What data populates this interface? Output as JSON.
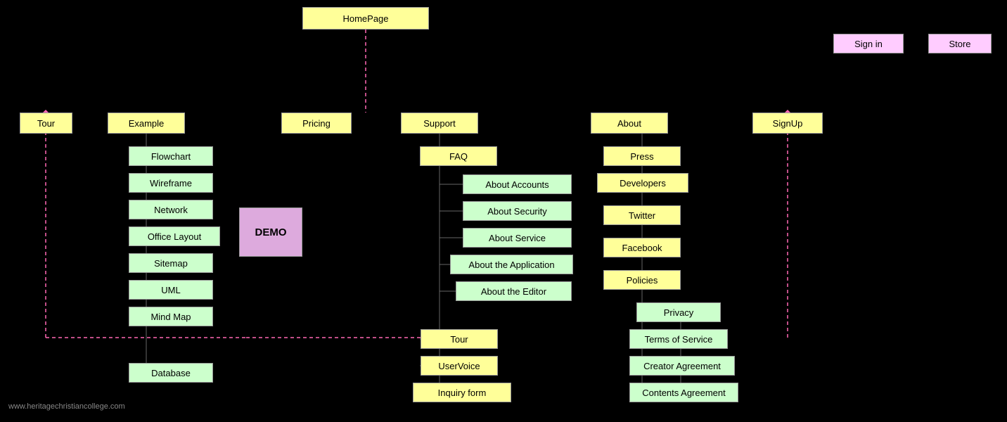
{
  "nodes": {
    "homepage": "HomePage",
    "signin": "Sign in",
    "store": "Store",
    "tour": "Tour",
    "example": "Example",
    "pricing": "Pricing",
    "support": "Support",
    "about": "About",
    "signup": "SignUp",
    "flowchart": "Flowchart",
    "wireframe": "Wireframe",
    "network": "Network",
    "officelayout": "Office Layout",
    "sitemap": "Sitemap",
    "uml": "UML",
    "mindmap": "Mind Map",
    "database": "Database",
    "demo": "DEMO",
    "faq": "FAQ",
    "aboutaccounts": "About Accounts",
    "aboutsecurity": "About Security",
    "aboutservice": "About Service",
    "aboutapp": "About the Application",
    "abouteditor": "About the Editor",
    "tour2": "Tour",
    "uservoice": "UserVoice",
    "inquiry": "Inquiry form",
    "press": "Press",
    "developers": "Developers",
    "twitter": "Twitter",
    "facebook": "Facebook",
    "policies": "Policies",
    "privacy": "Privacy",
    "tos": "Terms of Service",
    "creator": "Creator Agreement",
    "contents": "Contents Agreement"
  },
  "watermark": "www.heritagechristiancollege.com"
}
